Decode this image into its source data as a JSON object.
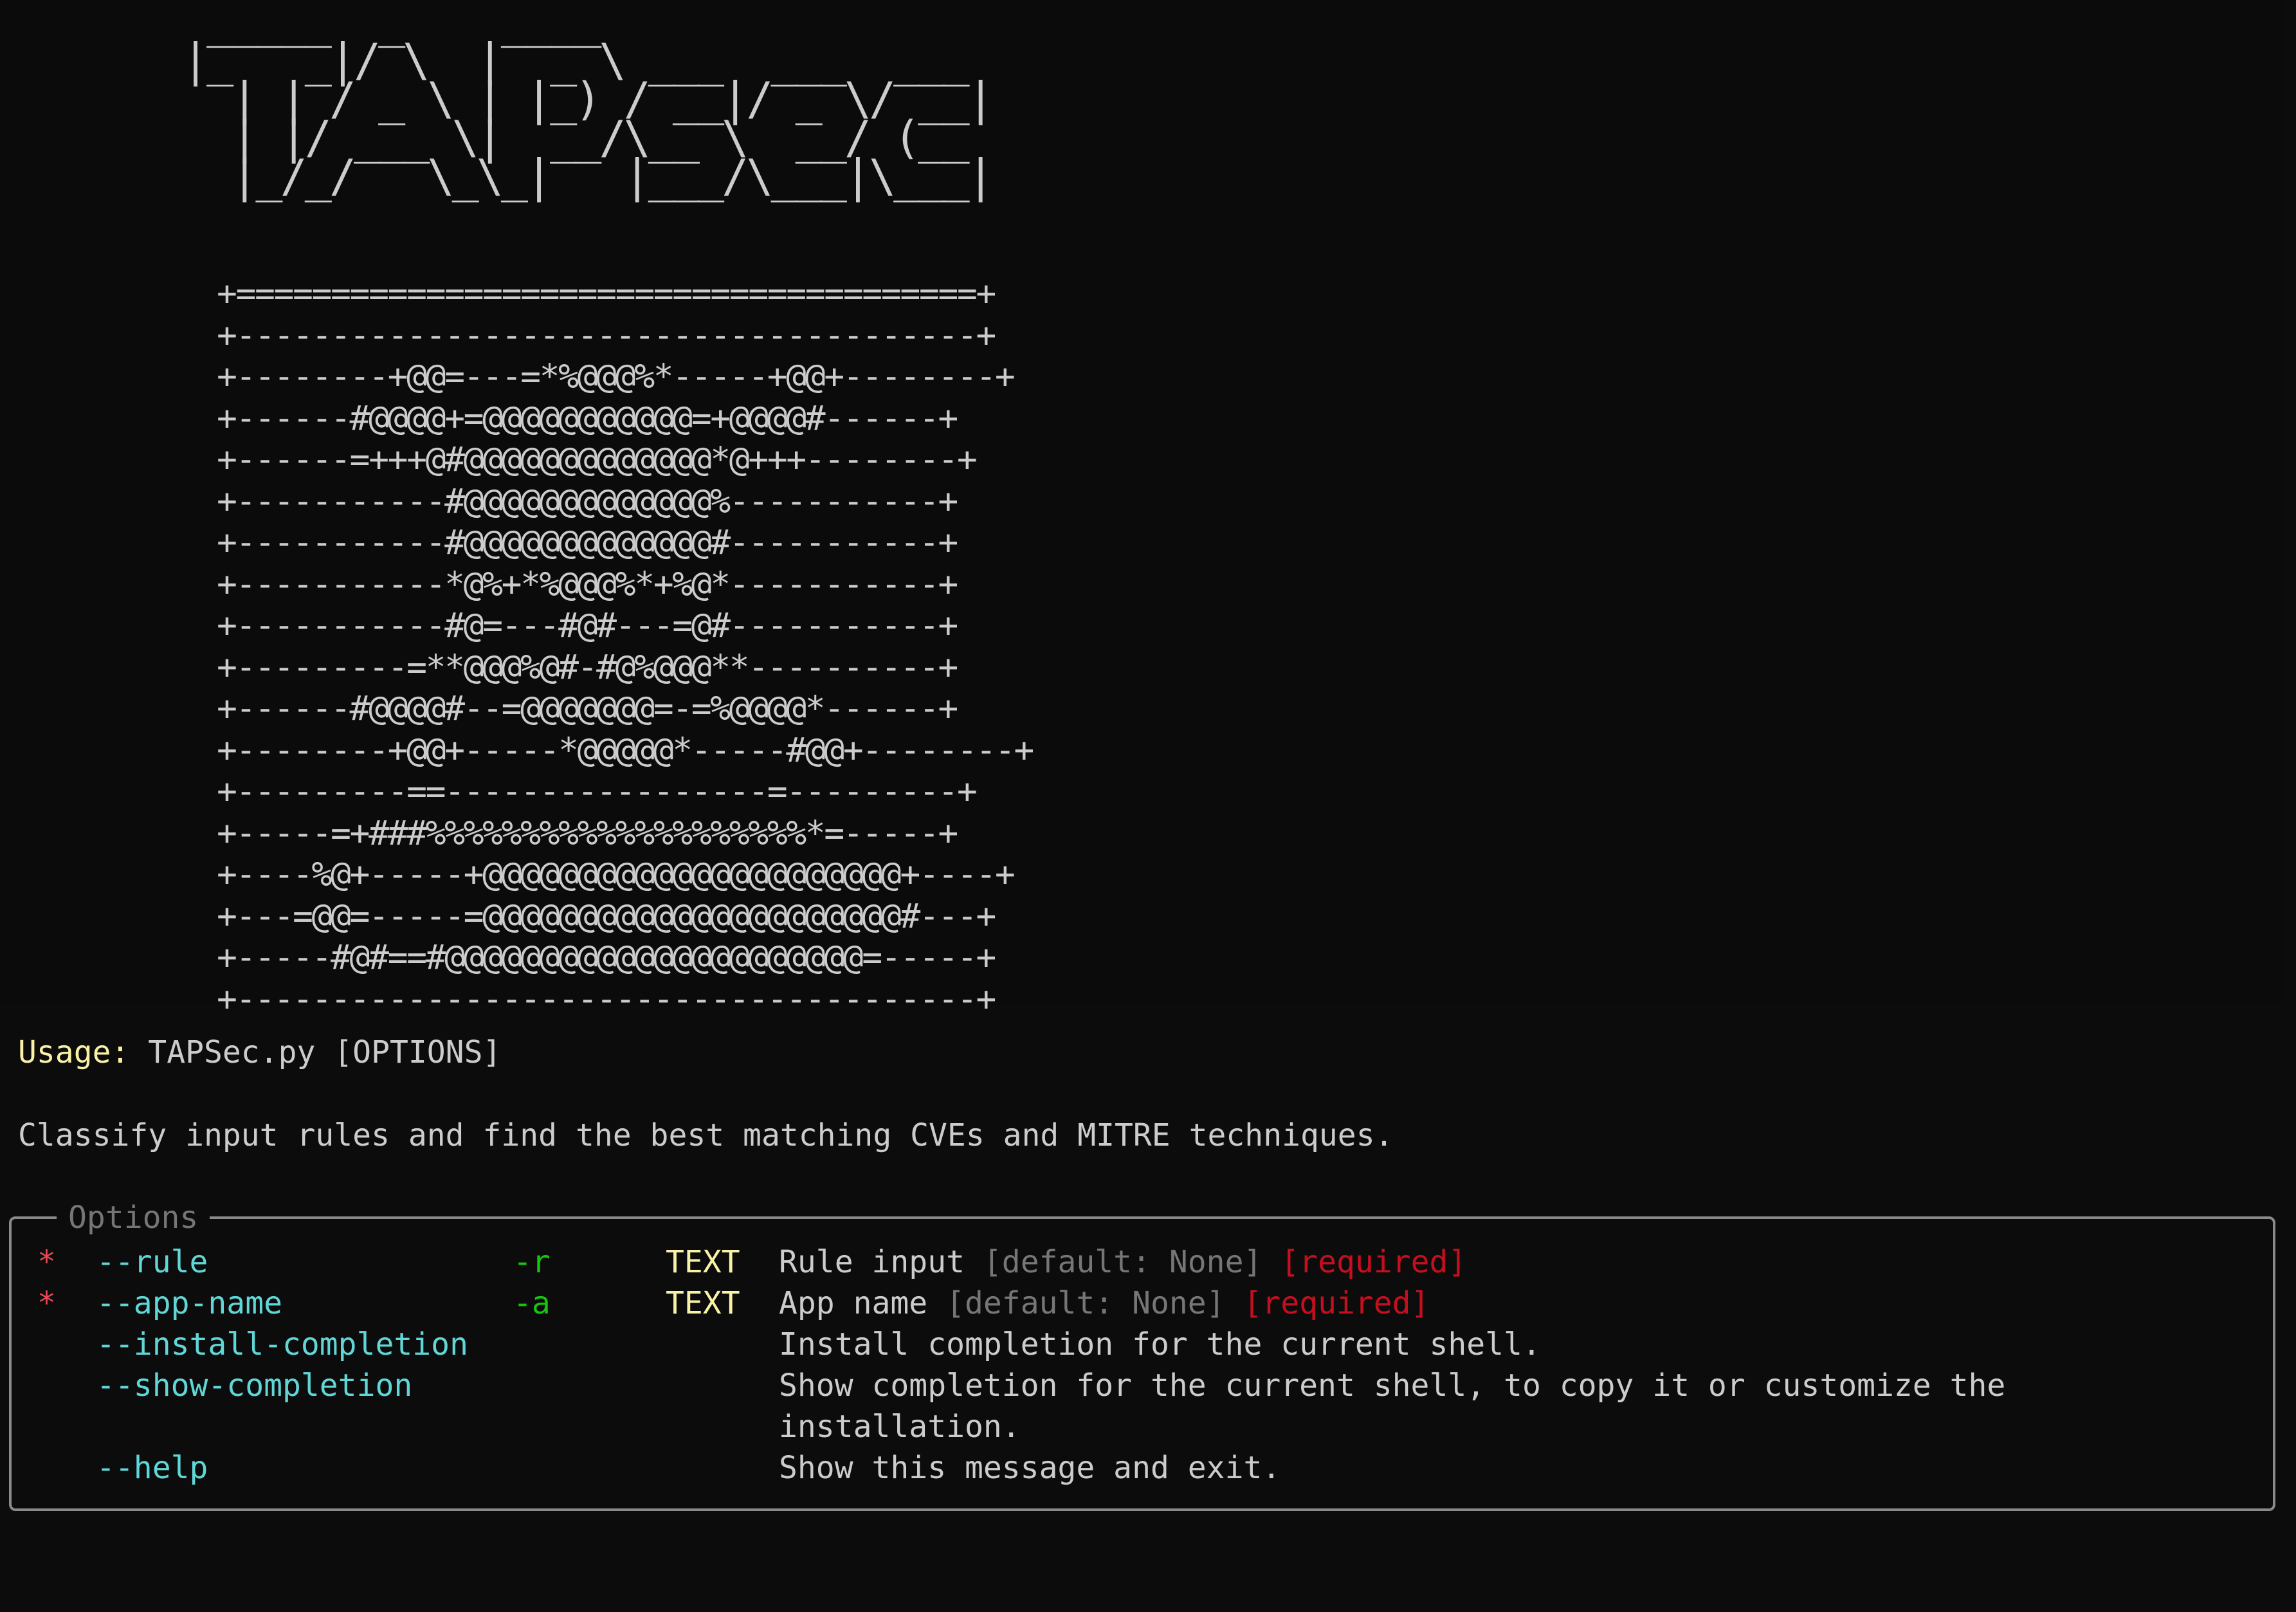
{
  "logo": {
    "ascii": " _____  _    ____\n|_   _|/ \\  |  _ \\ ___  ___  ___\n  | | / _ \\ | |_) / __|/ _ \\/ __|\n  | |/ ___ \\|  __/\\__ \\  __/ (__\n  |_/_/   \\_\\_|   |___/\\___|\\___|"
  },
  "shield": {
    "ascii": "+=======================================+\n+---------------------------------------+\n+--------+@@=---=*%@@@%*-----+@@+--------+\n+------#@@@@+=@@@@@@@@@@@=+@@@@#------+\n+------=+++@#@@@@@@@@@@@@@*@+++--------+\n+-----------#@@@@@@@@@@@@@%-----------+\n+-----------#@@@@@@@@@@@@@#-----------+\n+-----------*@%+*%@@@%*+%@*-----------+\n+-----------#@=---#@#---=@#-----------+\n+---------=**@@@%@#-#@%@@@**----------+\n+------#@@@@#--=@@@@@@@=-=%@@@@*------+\n+--------+@@+-----*@@@@@*-----#@@+--------+\n+---------==-----------------=---------+\n+-----=+###%%%%%%%%%%%%%%%%%%%%*=-----+\n+----%@+-----+@@@@@@@@@@@@@@@@@@@@@@+----+\n+---=@@=-----=@@@@@@@@@@@@@@@@@@@@@@#---+\n+-----#@#==#@@@@@@@@@@@@@@@@@@@@@@=-----+\n+---------------------------------------+"
  },
  "usage": {
    "label": "Usage:",
    "text": " TAPSec.py [OPTIONS]"
  },
  "description": "Classify input rules and find the best matching CVEs and MITRE techniques.",
  "options": {
    "title": "Options",
    "rows": [
      {
        "star": "*",
        "long": "--rule",
        "short": "-r",
        "metavar": "TEXT",
        "help": "Rule input ",
        "default": "[default: None]",
        "required": "[required]",
        "help_cont": ""
      },
      {
        "star": "*",
        "long": "--app-name",
        "short": "-a",
        "metavar": "TEXT",
        "help": "App name ",
        "default": "[default: None]",
        "required": "[required]",
        "help_cont": ""
      },
      {
        "star": "",
        "long": "--install-completion",
        "short": "",
        "metavar": "",
        "help": "Install completion for the current shell.",
        "default": "",
        "required": "",
        "help_cont": ""
      },
      {
        "star": "",
        "long": "--show-completion",
        "short": "",
        "metavar": "",
        "help": "Show completion for the current shell, to copy it or customize the",
        "default": "",
        "required": "",
        "help_cont": "installation."
      },
      {
        "star": "",
        "long": "--help",
        "short": "",
        "metavar": "",
        "help": "Show this message and exit.",
        "default": "",
        "required": "",
        "help_cont": ""
      }
    ]
  },
  "colors": {
    "background": "#0c0c0c",
    "foreground": "#cccccc",
    "usage_label": "#f9f1a5",
    "long_option": "#61d6d6",
    "short_option": "#16c60c",
    "metavar": "#f9f1a5",
    "required_star": "#e74856",
    "required_text": "#c50f1f",
    "dim": "#767676",
    "border": "#8a8a8a"
  }
}
